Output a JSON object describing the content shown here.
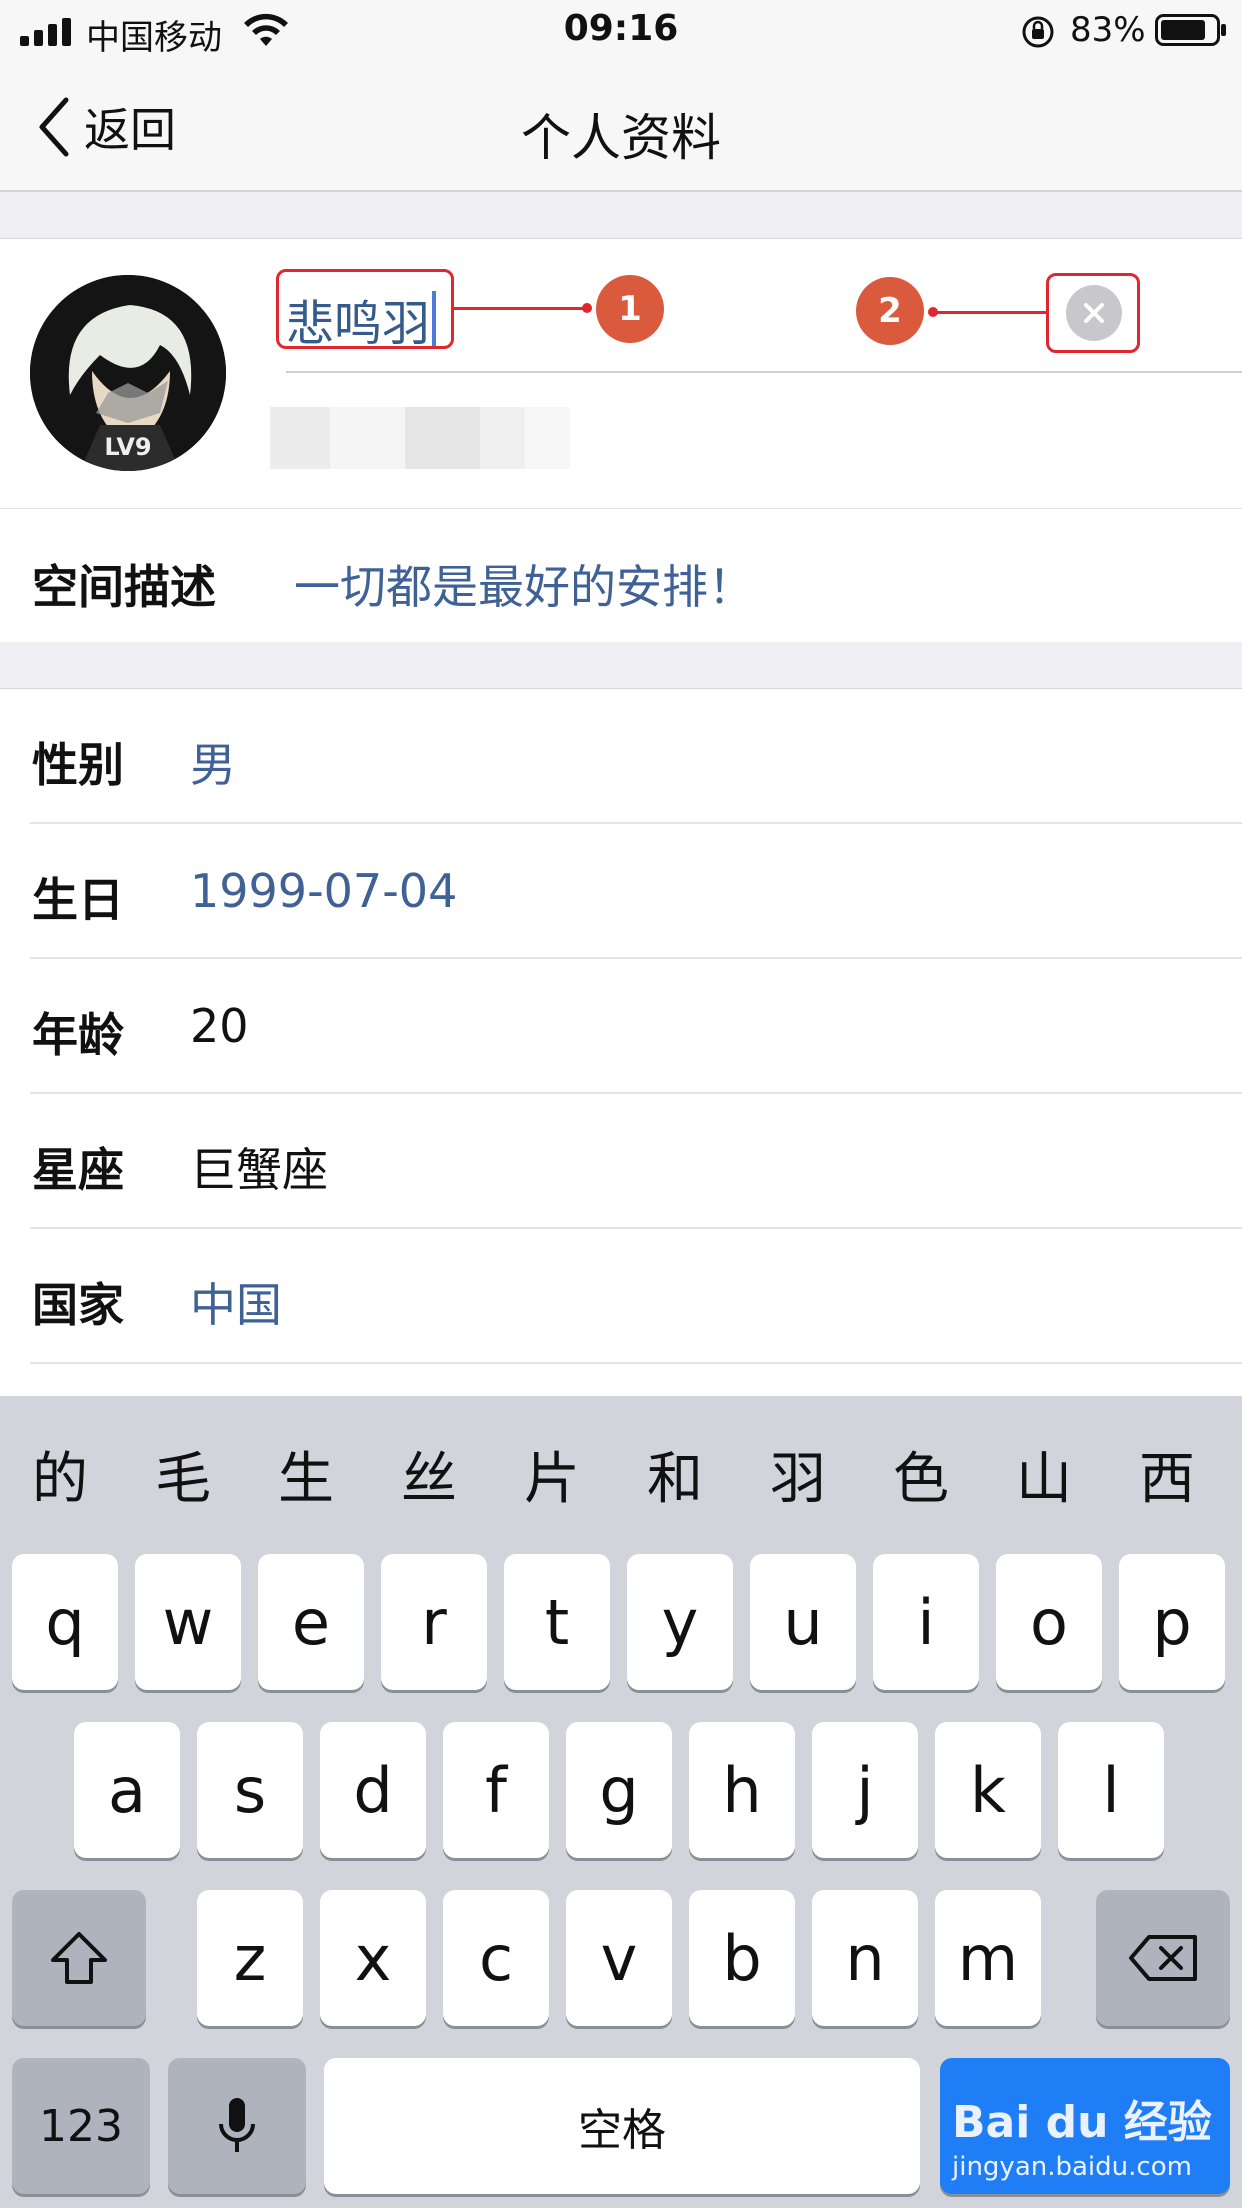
{
  "status_bar": {
    "carrier": "中国移动",
    "time": "09:16",
    "battery_percent": "83%",
    "icons": [
      "signal-icon",
      "wifi-icon",
      "orientation-lock-icon",
      "battery-icon"
    ]
  },
  "nav": {
    "back_label": "返回",
    "title": "个人资料"
  },
  "profile": {
    "name_value": "悲鸣羽",
    "avatar_badge": "LV9",
    "annotations": [
      "1",
      "2"
    ]
  },
  "description": {
    "label": "空间描述",
    "value": "一切都是最好的安排！"
  },
  "info_rows": [
    {
      "label": "性别",
      "value": "男",
      "style": "blue"
    },
    {
      "label": "生日",
      "value": "1999-07-04",
      "style": "blue"
    },
    {
      "label": "年龄",
      "value": "20",
      "style": "dark"
    },
    {
      "label": "星座",
      "value": "巨蟹座",
      "style": "dark"
    },
    {
      "label": "国家",
      "value": "中国",
      "style": "blue"
    }
  ],
  "keyboard": {
    "candidates": [
      "的",
      "毛",
      "生",
      "丝",
      "片",
      "和",
      "羽",
      "色",
      "山",
      "西"
    ],
    "row1": [
      "q",
      "w",
      "e",
      "r",
      "t",
      "y",
      "u",
      "i",
      "o",
      "p"
    ],
    "row2": [
      "a",
      "s",
      "d",
      "f",
      "g",
      "h",
      "j",
      "k",
      "l"
    ],
    "row3": [
      "z",
      "x",
      "c",
      "v",
      "b",
      "n",
      "m"
    ],
    "numbers_label": "123",
    "space_label": "空格"
  },
  "colors": {
    "accent_blue": "#3f6196",
    "annotation_red": "#e0262e",
    "badge_orange": "#d95a3c",
    "keyboard_bg": "#d1d4da",
    "return_key": "#1f7df6"
  },
  "watermark": {
    "logo_text": "Bai du 经验",
    "url": "jingyan.baidu.com"
  }
}
